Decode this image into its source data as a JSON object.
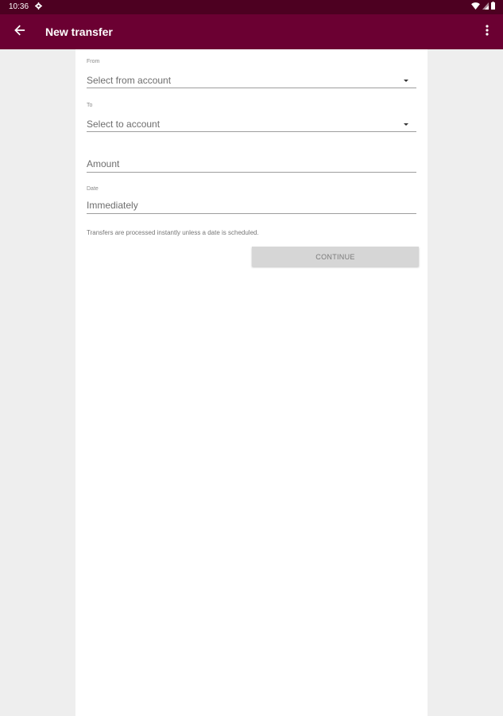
{
  "status_bar": {
    "time": "10:36",
    "icons": [
      "settings-icon",
      "wifi-icon",
      "signal-icon",
      "battery-icon"
    ]
  },
  "app_bar": {
    "title": "New transfer",
    "back_icon": "arrow-back-icon",
    "menu_icon": "more-vert-icon",
    "color": "#6b0032"
  },
  "form": {
    "from": {
      "label": "From",
      "value": "Select from account"
    },
    "to": {
      "label": "To",
      "value": "Select to account"
    },
    "amount": {
      "placeholder": "Amount"
    },
    "date": {
      "label": "Date",
      "value": "Immediately"
    },
    "helper_text": "Transfers are processed instantly unless a date is scheduled.",
    "continue_label": "CONTINUE"
  }
}
